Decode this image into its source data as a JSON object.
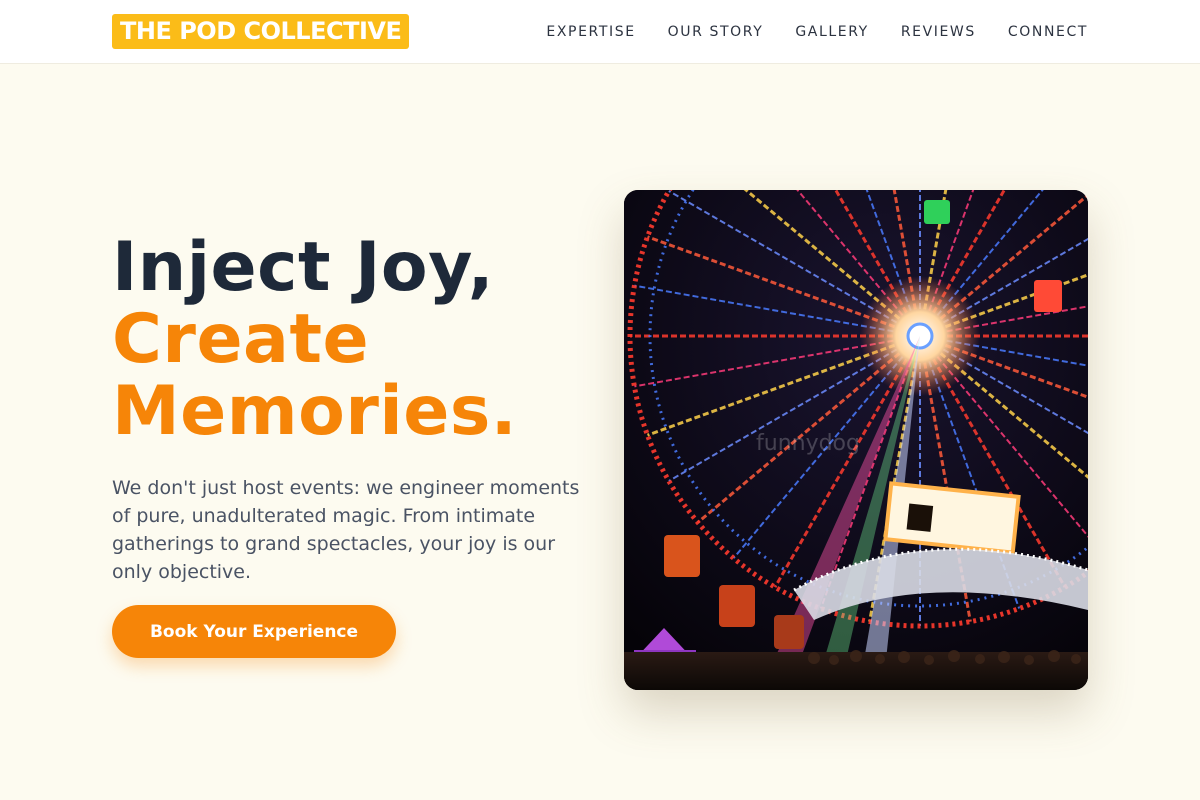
{
  "nav": {
    "logo": "THE POD COLLECTIVE",
    "links": [
      "EXPERTISE",
      "OUR STORY",
      "GALLERY",
      "REVIEWS",
      "CONNECT"
    ]
  },
  "hero": {
    "title_line1": "Inject Joy,",
    "title_line2": "Create",
    "title_line3": "Memories.",
    "description": "We don't just host events: we engineer moments of pure, unadulterated magic. From intimate gatherings to grand spectacles, your joy is our only objective.",
    "cta_label": "Book Your Experience",
    "image_watermark": "funnydog"
  },
  "colors": {
    "accent": "#f68508",
    "logo_bg": "#fbbc18",
    "heading": "#1e2939",
    "background": "#fdfbf0"
  },
  "icons": {
    "hero_image": "ferris-wheel-photo"
  }
}
